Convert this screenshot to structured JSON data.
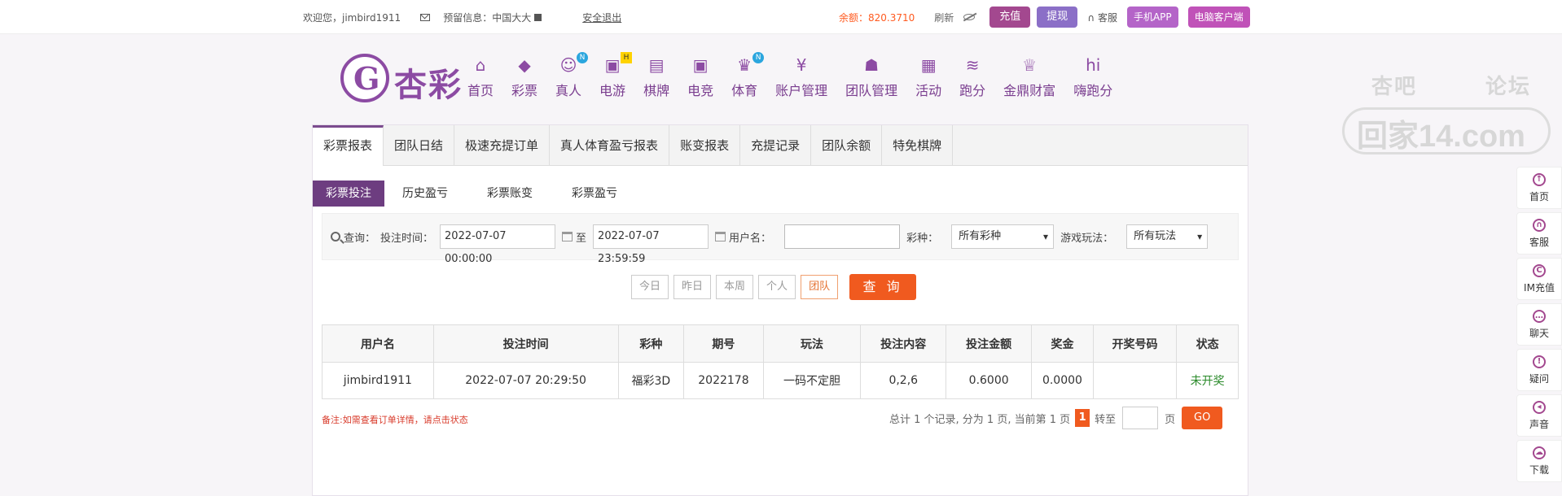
{
  "topbar": {
    "welcome": "欢迎您，jimbird1911",
    "reserved_label": "预留信息：中国大大",
    "logout": "安全退出",
    "balance": "余额：820.3710",
    "refresh": "刷新",
    "recharge": "充值",
    "withdraw": "提现",
    "service": "客服",
    "mobile_app": "手机APP",
    "pc_client": "电脑客户端"
  },
  "logo": {
    "text": "杏彩"
  },
  "nav": [
    {
      "label": "首页",
      "icon": "home-icon",
      "glyph": "⌂"
    },
    {
      "label": "彩票",
      "icon": "lottery-icon",
      "glyph": "◆"
    },
    {
      "label": "真人",
      "icon": "live-icon",
      "glyph": "☺",
      "badge": "N"
    },
    {
      "label": "电游",
      "icon": "gamepad-icon",
      "glyph": "▣",
      "badge": "H"
    },
    {
      "label": "棋牌",
      "icon": "cards-icon",
      "glyph": "▤"
    },
    {
      "label": "电竞",
      "icon": "esports-icon",
      "glyph": "▣"
    },
    {
      "label": "体育",
      "icon": "trophy-icon",
      "glyph": "♛",
      "badge": "N"
    },
    {
      "label": "账户管理",
      "icon": "account-icon",
      "glyph": "¥"
    },
    {
      "label": "团队管理",
      "icon": "team-icon",
      "glyph": "☗"
    },
    {
      "label": "活动",
      "icon": "gift-icon",
      "glyph": "▦"
    },
    {
      "label": "跑分",
      "icon": "runscore-icon",
      "glyph": "≋"
    },
    {
      "label": "金鼎财富",
      "icon": "wealth-icon",
      "glyph": "♕"
    },
    {
      "label": "嗨跑分",
      "icon": "hi-icon",
      "glyph": "hi"
    }
  ],
  "watermark": {
    "t1": "杏吧",
    "t2": "论坛",
    "t3": "回家14.com"
  },
  "tabs": [
    "彩票报表",
    "团队日结",
    "极速充提订单",
    "真人体育盈亏报表",
    "账变报表",
    "充提记录",
    "团队余额",
    "特免棋牌"
  ],
  "subtabs": [
    "彩票投注",
    "历史盈亏",
    "彩票账变",
    "彩票盈亏"
  ],
  "query": {
    "label": "查询：",
    "time_label": "投注时间：",
    "start": "2022-07-07 00:00:00",
    "to": "至",
    "end": "2022-07-07 23:59:59",
    "user_label": "用户名：",
    "lottery_label": "彩种：",
    "lottery_value": "所有彩种",
    "play_label": "游戏玩法：",
    "play_value": "所有玩法"
  },
  "quick_buttons": [
    "今日",
    "昨日",
    "本周",
    "个人",
    "团队"
  ],
  "search_button": "查 询",
  "table": {
    "headers": [
      "用户名",
      "投注时间",
      "彩种",
      "期号",
      "玩法",
      "投注内容",
      "投注金额",
      "奖金",
      "开奖号码",
      "状态"
    ],
    "rows": [
      [
        "jimbird1911",
        "2022-07-07 20:29:50",
        "福彩3D",
        "2022178",
        "一码不定胆",
        "0,2,6",
        "0.6000",
        "0.0000",
        "",
        "未开奖"
      ]
    ]
  },
  "remark": "备注:如需查看订单详情，请点击状态",
  "pager": {
    "summary": "总计 1 个记录, 分为 1 页, 当前第 1 页",
    "current": "1",
    "goto": "转至",
    "page": "页",
    "go": "GO"
  },
  "sidebar": [
    {
      "label": "首页",
      "icon": "up-arrow-icon",
      "glyph": "↑"
    },
    {
      "label": "客服",
      "icon": "headset-icon",
      "glyph": "∩"
    },
    {
      "label": "IM充值",
      "icon": "im-recharge-icon",
      "glyph": "C"
    },
    {
      "label": "聊天",
      "icon": "chat-icon",
      "glyph": "…"
    },
    {
      "label": "疑问",
      "icon": "question-icon",
      "glyph": "!"
    },
    {
      "label": "声音",
      "icon": "sound-icon",
      "glyph": "◂"
    },
    {
      "label": "下载",
      "icon": "cloud-icon",
      "glyph": "☁"
    }
  ]
}
